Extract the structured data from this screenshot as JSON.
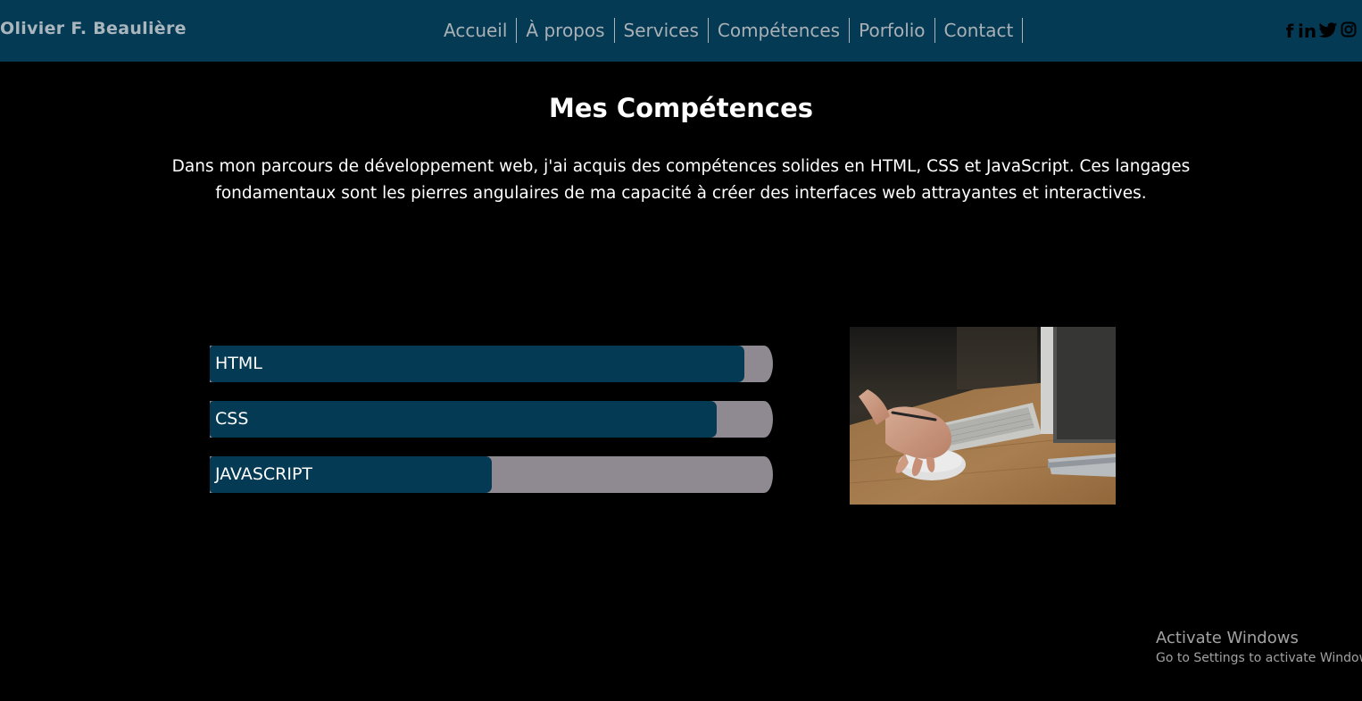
{
  "header": {
    "brand": "Olivier F. Beaulière",
    "nav": [
      "Accueil",
      "À propos",
      "Services",
      "Compétences",
      "Porfolio",
      "Contact"
    ],
    "social": {
      "facebook": "f",
      "linkedin": "in",
      "twitter_icon": "twitter-icon",
      "instagram_icon": "instagram-icon"
    },
    "colors": {
      "bar": "#043a54",
      "text": "#a9b0b6"
    }
  },
  "main": {
    "title": "Mes Compétences",
    "description": "Dans mon parcours de développement web, j'ai acquis des compétences solides en HTML, CSS et JavaScript. Ces langages fondamentaux sont les pierres angulaires de ma capacité à créer des interfaces web attrayantes et interactives.",
    "skills": [
      {
        "label": "HTML",
        "percent": 95
      },
      {
        "label": "CSS",
        "percent": 90
      },
      {
        "label": "JAVASCRIPT",
        "percent": 50
      }
    ],
    "photo_icon": "computer-mouse-photo",
    "colors": {
      "fill": "#043a54",
      "track": "#8f8a91"
    }
  },
  "watermark": {
    "line1": "Activate Windows",
    "line2": "Go to Settings to activate Windows."
  }
}
